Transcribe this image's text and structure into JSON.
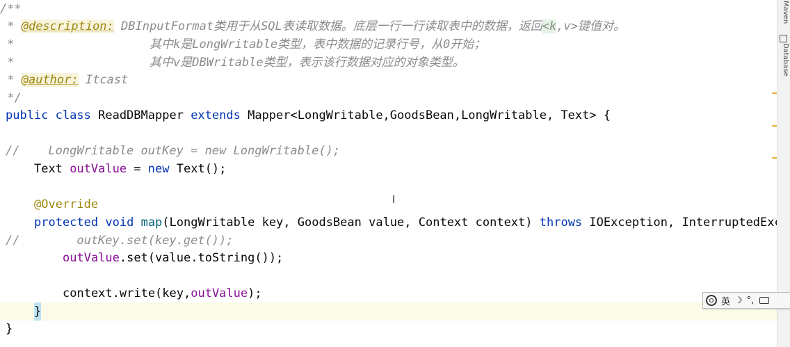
{
  "editor": {
    "javadoc": {
      "open": "/**",
      "desc_prefix": " * ",
      "desc_tag": "@description:",
      "desc_text_a": " DBInputFormat类用于从SQL表读取数据。底层一行一行读取表中的数据，返回",
      "desc_hl": "<k",
      "desc_text_b": ",v>键值对。",
      "line2_star": " *",
      "line2_text": "其中k是LongWritable类型，表中数据的记录行号，从0开始；",
      "line3_star": " *",
      "line3_text": "其中v是DBWritable类型，表示该行数据对应的对象类型。",
      "author_prefix": " * ",
      "author_tag": "@author:",
      "author_value": " Itcast",
      "close": " */"
    },
    "class_decl": {
      "kw_public": "public",
      "kw_class": "class",
      "class_name": "ReadDBMapper",
      "kw_extends": "extends",
      "rest": "Mapper<LongWritable,GoodsBean,LongWritable, Text> {"
    },
    "commented_field": "//    LongWritable outKey = new LongWritable();",
    "field_line": {
      "type": "Text ",
      "name": "outValue",
      "eq": " = ",
      "kw_new": "new",
      "rest": " Text();"
    },
    "override": "@Override",
    "method_decl": {
      "kw_protected": "protected",
      "kw_void": "void",
      "name": "map",
      "params": "(LongWritable key, GoodsBean value, Context context) ",
      "kw_throws": "throws",
      "exceptions": " IOException, InterruptedExc"
    },
    "commented_set": "//        outKey.set(key.get());",
    "set_line": {
      "field": "outValue",
      "rest": ".set(value.toString());"
    },
    "write_line": {
      "pre": "context.write(key,",
      "field": "outValue",
      "post": ");"
    },
    "method_close": "}",
    "class_close": "}"
  },
  "right_toolwindows": [
    "Maven",
    "Database"
  ],
  "ime_toolbar": {
    "lang": "英",
    "moon": "☽",
    "punct": "°,"
  },
  "colors": {
    "keyword": "#0033b3",
    "comment": "#8c8c8c",
    "annotation": "#9e880d",
    "field": "#871094",
    "current_line": "#fcfbe8",
    "stripe_mark": "#e8b23a"
  }
}
